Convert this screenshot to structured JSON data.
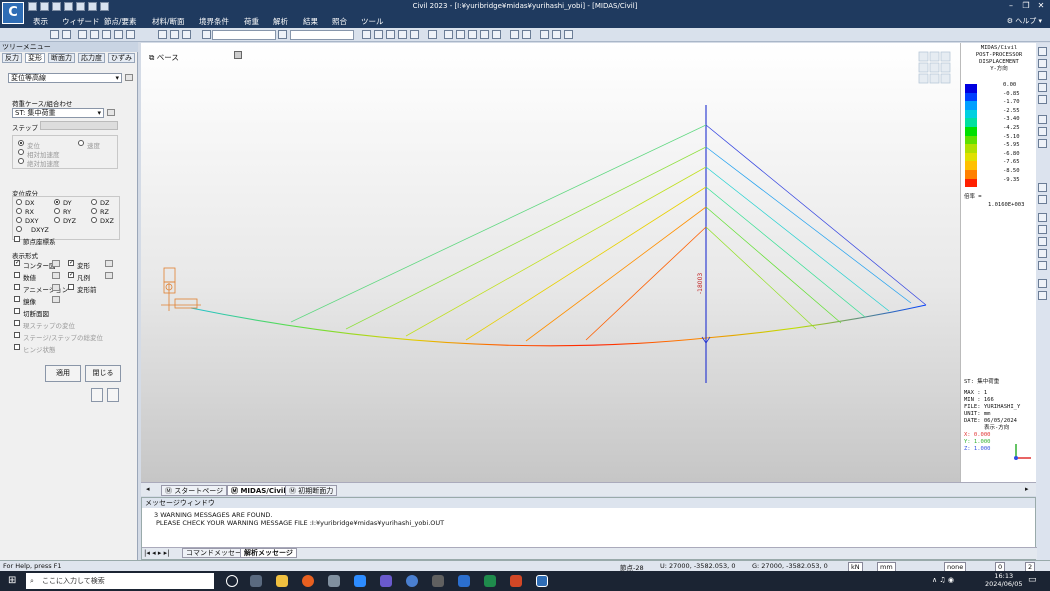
{
  "app": {
    "logo": "C",
    "title": "Civil 2023 - [I:¥yuribridge¥midas¥yurihashi_yobi] - [MIDAS/Civil]",
    "help": "ヘルプ"
  },
  "menu": [
    "表示",
    "ウィザード",
    "節点/要素",
    "材料/断面",
    "境界条件",
    "荷重",
    "解析",
    "結果",
    "照合",
    "ツール"
  ],
  "left": {
    "header": "ツリーメニュー",
    "tabs": [
      "反力",
      "変形",
      "断面力",
      "応力度",
      "ひずみ"
    ],
    "result_type": "変位等高線",
    "loadcase_label": "荷重ケース/組合わせ",
    "loadcase": "ST: 集中荷重",
    "step_label": "ステップ",
    "type_opts": [
      "変位",
      "速度",
      "相対加速度",
      "絶対加速度"
    ],
    "component_label": "変位成分",
    "components": [
      "DX",
      "DY",
      "DZ",
      "RX",
      "RY",
      "RZ",
      "DXY",
      "DYZ",
      "DXZ",
      "DXYZ"
    ],
    "local_label": "節点座標系",
    "display_label": "表示形式",
    "display_opts": [
      "コンター図",
      "変形",
      "数値",
      "凡例",
      "アニメーション",
      "変形前",
      "鏡像",
      "切断面図"
    ],
    "extra_opts": [
      "現ステップの変位",
      "ステージ/ステップの総変位",
      "ヒンジ状態"
    ],
    "apply": "適用",
    "close": "閉じる"
  },
  "viewport": {
    "view_label": "ベース",
    "value_label": "-18003"
  },
  "legend": {
    "header1": "MIDAS/Civil",
    "header2": "POST-PROCESSOR",
    "header3": "DISPLACEMENT",
    "component": "Y-方向",
    "values": [
      "0.00",
      "-0.85",
      "-1.70",
      "-2.55",
      "-3.40",
      "-4.25",
      "-5.10",
      "-5.95",
      "-6.80",
      "-7.65",
      "-8.50",
      "-9.35"
    ],
    "colors": [
      "#0000e0",
      "#0040ff",
      "#00a0ff",
      "#00d0e0",
      "#00e0a0",
      "#00e000",
      "#60e000",
      "#b0e000",
      "#e0e000",
      "#ffc000",
      "#ff8000",
      "#ff2000"
    ],
    "scale_label": "倍率 =",
    "scale_value": "1.0160E+003",
    "case": "ST: 集中荷重",
    "max": "MAX : 1",
    "min": "MIN : 166",
    "file": "FILE: YURIHASHI_Y",
    "unit": "UNIT: mm",
    "date": "DATE: 06/05/2024",
    "dir": "表示-方向",
    "x": "X: 0.000",
    "y": "Y: 1.000",
    "z": "Z: 1.000"
  },
  "tabs": [
    "スタートページ",
    "MIDAS/Civil",
    "初期断面力"
  ],
  "message": {
    "title": "メッセージウィンドウ",
    "line1": "3 WARNING MESSAGES ARE FOUND.",
    "line2": "PLEASE CHECK YOUR WARNING MESSAGE FILE :I:¥yuribridge¥midas¥yurihashi_yobi.OUT",
    "tab1": "コマンドメッセージ",
    "tab2": "解析メッセージ"
  },
  "status": {
    "help": "For Help, press F1",
    "node": "節点-28",
    "u": "U: 27000, -3582.053, 0",
    "g": "G: 27000, -3582.053, 0",
    "force": "kN",
    "len": "mm",
    "none": "none",
    "page": "0",
    "pages": "2"
  },
  "taskbar": {
    "search": "ここに入力して検索",
    "time": "16:13",
    "date": "2024/06/05"
  }
}
